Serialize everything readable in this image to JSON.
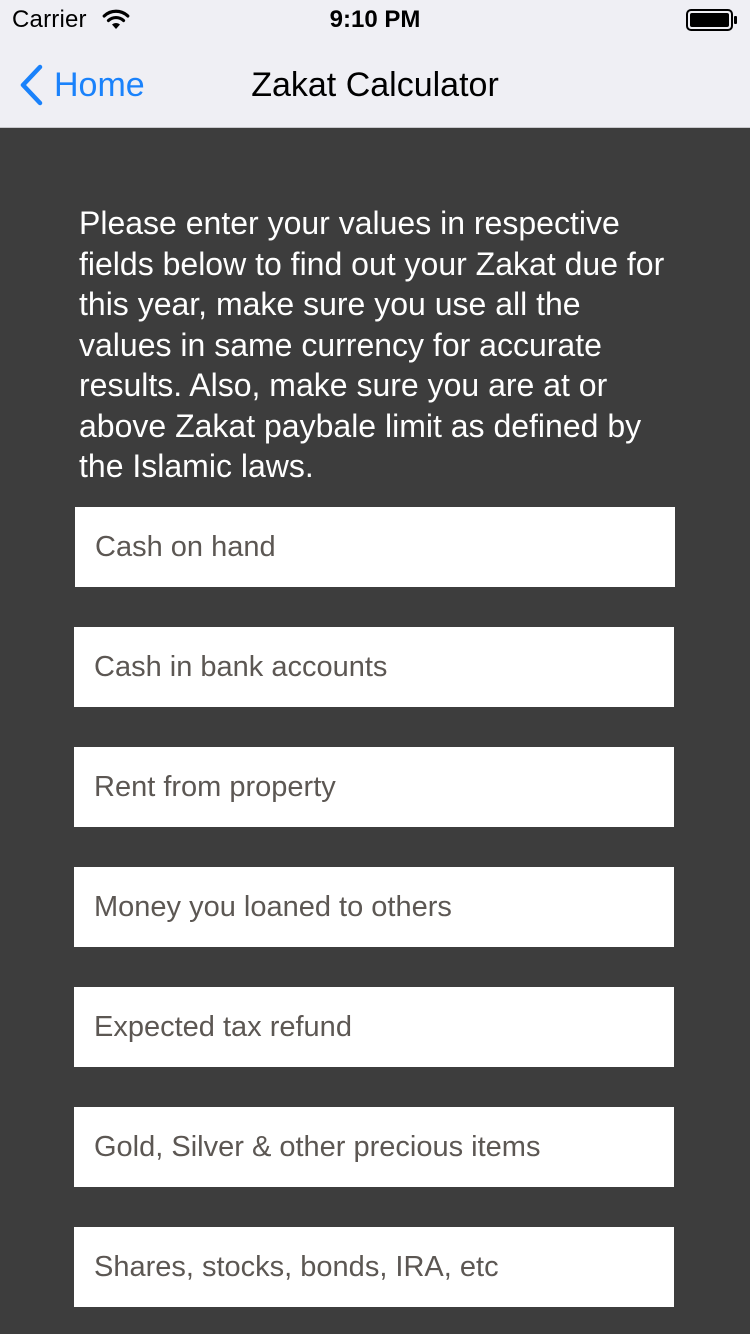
{
  "status_bar": {
    "carrier": "Carrier",
    "time": "9:10 PM"
  },
  "nav": {
    "back_label": "Home",
    "title": "Zakat Calculator"
  },
  "intro_text": "Please enter your values in respective fields below to find out your Zakat due for this year, make sure you use all the values in same currency for accurate results. Also, make sure you are at or above Zakat paybale limit as defined by the Islamic laws.",
  "fields": {
    "cash_on_hand": {
      "placeholder": "Cash on hand",
      "value": ""
    },
    "cash_in_bank": {
      "placeholder": "Cash in bank accounts",
      "value": ""
    },
    "rent_from_property": {
      "placeholder": "Rent from property",
      "value": ""
    },
    "money_loaned": {
      "placeholder": "Money you loaned to others",
      "value": ""
    },
    "tax_refund": {
      "placeholder": "Expected tax refund",
      "value": ""
    },
    "precious_items": {
      "placeholder": "Gold, Silver & other precious items",
      "value": ""
    },
    "investments": {
      "placeholder": "Shares, stocks, bonds, IRA, etc",
      "value": ""
    }
  },
  "colors": {
    "background": "#3d3d3d",
    "nav_background": "#efeff4",
    "accent": "#1a82fb",
    "field_background": "#ffffff",
    "placeholder": "#5c5753"
  },
  "icons": {
    "wifi": "wifi-icon",
    "battery": "battery-icon",
    "back": "chevron-left-icon"
  }
}
